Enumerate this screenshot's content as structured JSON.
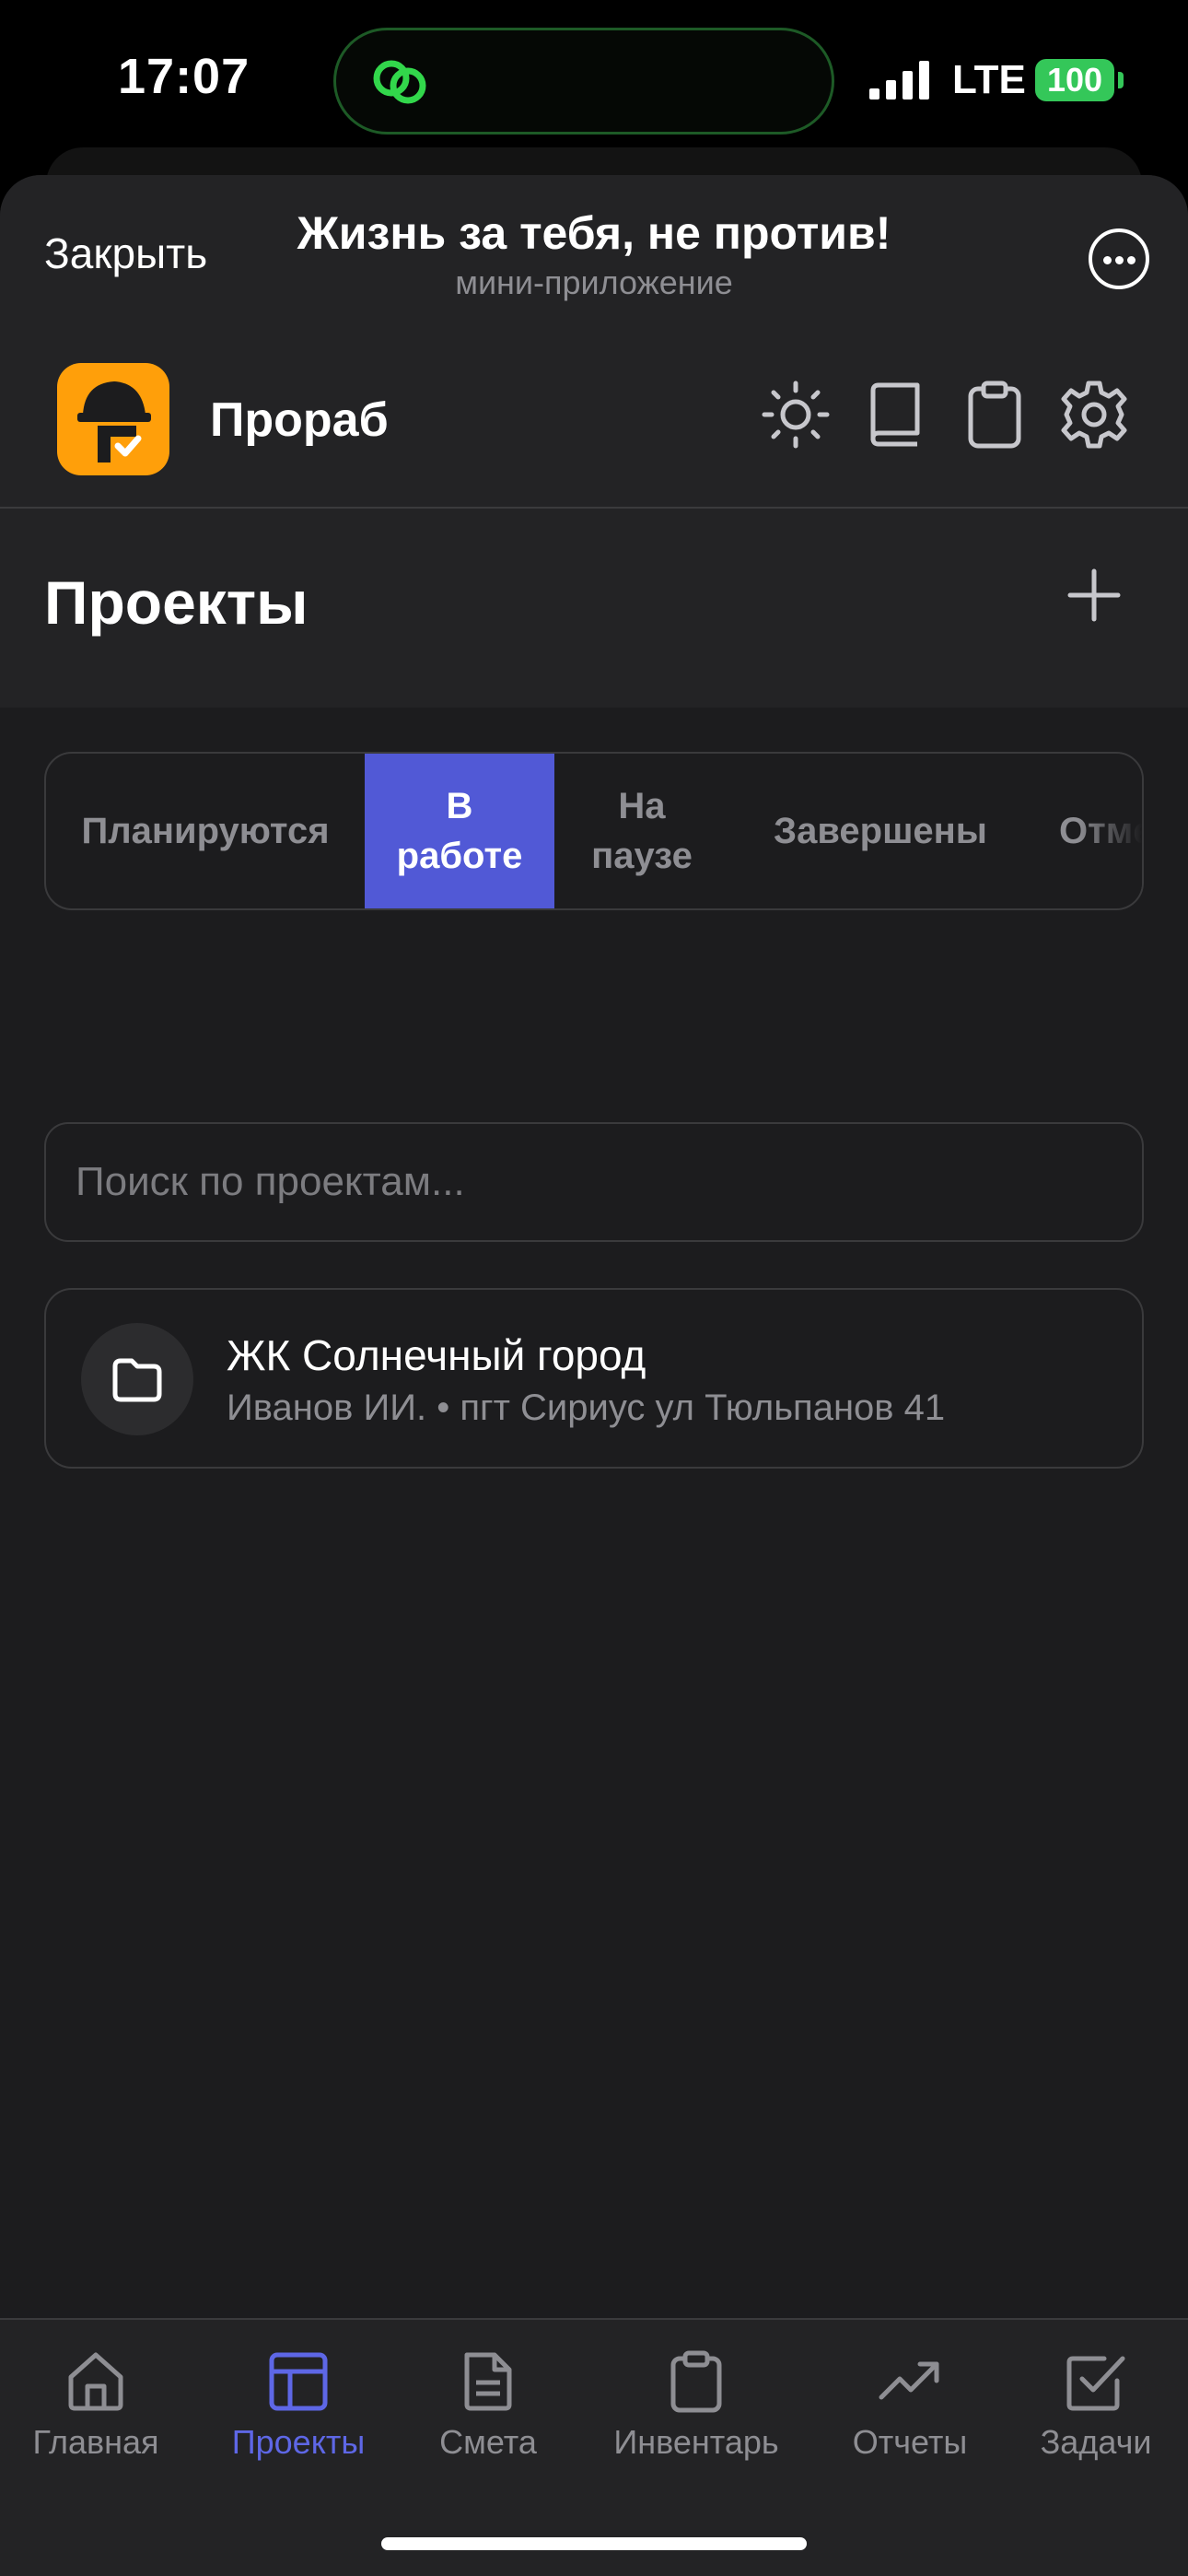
{
  "status_bar": {
    "time": "17:07",
    "network": "LTE",
    "battery": "100",
    "battery_color": "#34c759",
    "island_icon": "link-rings-icon"
  },
  "mini_app": {
    "close_label": "Закрыть",
    "title": "Жизнь за тебя, не против!",
    "subtitle": "мини-приложение",
    "more_icon": "more-icon"
  },
  "app_header": {
    "name": "Прораб",
    "logo_color": "#ff9f0a",
    "icons": [
      "sun-icon",
      "book-icon",
      "clipboard-icon",
      "gear-icon"
    ]
  },
  "page": {
    "title": "Проекты",
    "add_icon": "plus-icon"
  },
  "tabs": [
    {
      "label": "Планируются",
      "active": false
    },
    {
      "label": "В\nработе",
      "active": true
    },
    {
      "label": "На\nпаузе",
      "active": false
    },
    {
      "label": "Завершены",
      "active": false
    },
    {
      "label": "Отмен",
      "active": false
    }
  ],
  "accent_color": "#5159d6",
  "search": {
    "placeholder": "Поиск по проектам...",
    "value": ""
  },
  "projects": [
    {
      "title": "ЖК Солнечный город",
      "meta": "Иванов ИИ. • пгт Сириус ул Тюльпанов 41",
      "icon": "folder-icon"
    }
  ],
  "bottom_nav": [
    {
      "label": "Главная",
      "icon": "home-icon",
      "active": false
    },
    {
      "label": "Проекты",
      "icon": "projects-icon",
      "active": true
    },
    {
      "label": "Смета",
      "icon": "document-icon",
      "active": false
    },
    {
      "label": "Инвентарь",
      "icon": "clipboard-icon",
      "active": false
    },
    {
      "label": "Отчеты",
      "icon": "trend-icon",
      "active": false
    },
    {
      "label": "Задачи",
      "icon": "checkbox-icon",
      "active": false
    }
  ]
}
